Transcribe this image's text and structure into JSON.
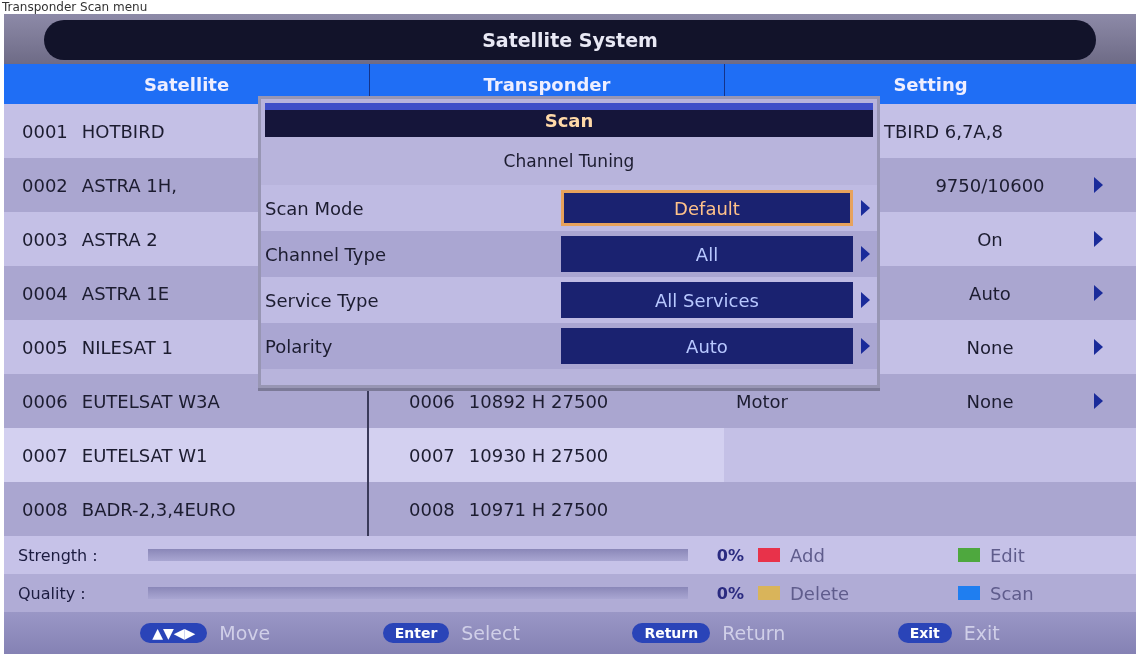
{
  "caption": "Transponder Scan menu",
  "title": "Satellite System",
  "columns": [
    "Satellite",
    "Transponder",
    "Setting"
  ],
  "rows": [
    {
      "satellite": {
        "number": "0001",
        "name": "HOTBIRD"
      },
      "transponder": null,
      "setting": {
        "kind": "text",
        "value": "TBIRD 6,7A,8"
      },
      "selected": false
    },
    {
      "satellite": {
        "number": "0002",
        "name": "ASTRA 1H,"
      },
      "transponder": null,
      "setting": {
        "kind": "option",
        "value": "9750/10600"
      },
      "selected": false
    },
    {
      "satellite": {
        "number": "0003",
        "name": "ASTRA 2"
      },
      "transponder": null,
      "setting": {
        "kind": "option",
        "value": "On"
      },
      "selected": false
    },
    {
      "satellite": {
        "number": "0004",
        "name": "ASTRA 1E"
      },
      "transponder": null,
      "setting": {
        "kind": "option",
        "value": "Auto"
      },
      "selected": false
    },
    {
      "satellite": {
        "number": "0005",
        "name": "NILESAT 1"
      },
      "transponder": null,
      "setting": {
        "kind": "option",
        "value": "None"
      },
      "selected": false
    },
    {
      "satellite": {
        "number": "0006",
        "name": "EUTELSAT W3A"
      },
      "transponder": {
        "number": "0006",
        "value": "10892 H 27500"
      },
      "setting": {
        "kind": "option",
        "label": "Motor",
        "value": "None"
      },
      "selected": false
    },
    {
      "satellite": {
        "number": "0007",
        "name": "EUTELSAT W1"
      },
      "transponder": {
        "number": "0007",
        "value": "10930 H 27500"
      },
      "setting": null,
      "selected": true
    },
    {
      "satellite": {
        "number": "0008",
        "name": "BADR-2,3,4EURO"
      },
      "transponder": {
        "number": "0008",
        "value": "10971 H 27500"
      },
      "setting": null,
      "selected": false
    }
  ],
  "meters": [
    {
      "label": "Strength :",
      "level": 0,
      "reading": "0%"
    },
    {
      "label": "Quality :",
      "level": 0,
      "reading": "0%"
    }
  ],
  "legend": [
    {
      "label": "Add",
      "color": "#e8324a"
    },
    {
      "label": "Edit",
      "color": "#4ea83e"
    },
    {
      "label": "Delete",
      "color": "#d9b45a"
    },
    {
      "label": "Scan",
      "color": "#1f7ef0"
    }
  ],
  "dialog": {
    "title": "Scan",
    "subtitle": "Channel Tuning",
    "options": [
      {
        "label": "Scan Mode",
        "value": "Default",
        "focused": true
      },
      {
        "label": "Channel Type",
        "value": "All",
        "focused": false
      },
      {
        "label": "Service Type",
        "value": "All Services",
        "focused": false
      },
      {
        "label": "Polarity",
        "value": "Auto",
        "focused": false
      }
    ]
  },
  "footer": [
    {
      "key": "▲▼◀▶",
      "action": "Move"
    },
    {
      "key": "Enter",
      "action": "Select"
    },
    {
      "key": "Return",
      "action": "Return"
    },
    {
      "key": "Exit",
      "action": "Exit"
    }
  ]
}
